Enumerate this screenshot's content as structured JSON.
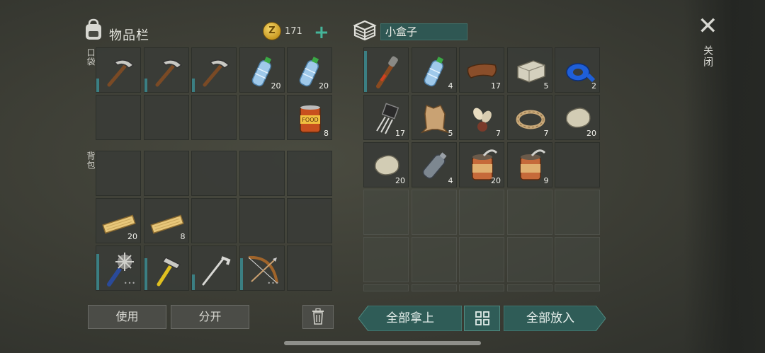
{
  "inventory": {
    "title": "物品栏",
    "coins": "171",
    "coin_symbol": "Z",
    "add_label": "+",
    "pockets_label": "口袋",
    "backpack_label": "背包",
    "pockets": [
      {
        "item": "pickaxe-icon",
        "count": "",
        "durability": 0.3
      },
      {
        "item": "pickaxe-icon",
        "count": "",
        "durability": 0.3
      },
      {
        "item": "pickaxe-icon",
        "count": "",
        "durability": 0.3
      },
      {
        "item": "water-bottle-icon",
        "count": "20"
      },
      {
        "item": "water-bottle-icon",
        "count": "20"
      },
      {
        "item": "",
        "count": ""
      },
      {
        "item": "",
        "count": ""
      },
      {
        "item": "",
        "count": ""
      },
      {
        "item": "",
        "count": ""
      },
      {
        "item": "canned-food-icon",
        "count": "8"
      }
    ],
    "backpack": [
      {
        "item": "",
        "count": ""
      },
      {
        "item": "",
        "count": ""
      },
      {
        "item": "",
        "count": ""
      },
      {
        "item": "",
        "count": ""
      },
      {
        "item": "",
        "count": ""
      },
      {
        "item": "plank-icon",
        "count": "20"
      },
      {
        "item": "plank-icon",
        "count": "8"
      },
      {
        "item": "",
        "count": ""
      },
      {
        "item": "",
        "count": ""
      },
      {
        "item": "",
        "count": ""
      },
      {
        "item": "spiked-club-icon",
        "count": "",
        "durability": 0.8,
        "dots": "•••"
      },
      {
        "item": "hammer-icon",
        "count": "",
        "durability": 0.7
      },
      {
        "item": "hoe-icon",
        "count": "",
        "durability": 0.35
      },
      {
        "item": "bow-icon",
        "count": "",
        "durability": 0.7,
        "dots": "•••"
      },
      {
        "item": "",
        "count": ""
      }
    ],
    "use_label": "使用",
    "split_label": "分开",
    "trash_icon": "trash-icon"
  },
  "container": {
    "title": "小盒子",
    "items": [
      {
        "item": "torch-icon",
        "count": "",
        "durability": 0.9
      },
      {
        "item": "water-bottle-icon",
        "count": "4"
      },
      {
        "item": "leather-icon",
        "count": "17"
      },
      {
        "item": "stone-block-icon",
        "count": "5"
      },
      {
        "item": "duct-tape-icon",
        "count": "2"
      },
      {
        "item": "transistor-icon",
        "count": "17"
      },
      {
        "item": "animal-hide-icon",
        "count": "5"
      },
      {
        "item": "seeds-icon",
        "count": "7"
      },
      {
        "item": "rope-icon",
        "count": "7"
      },
      {
        "item": "stone-icon",
        "count": "20"
      },
      {
        "item": "stone-icon",
        "count": "20"
      },
      {
        "item": "empty-bottle-icon",
        "count": "4"
      },
      {
        "item": "open-can-icon",
        "count": "20"
      },
      {
        "item": "open-can-icon",
        "count": "9"
      },
      {
        "item": "",
        "count": ""
      }
    ],
    "take_all_label": "全部拿上",
    "sort_icon": "grid-sort-icon",
    "put_all_label": "全部放入"
  },
  "close": {
    "icon": "close-icon",
    "label": "关闭"
  },
  "colors": {
    "accent_teal": "#2f5c57",
    "durability": "#3b7f83",
    "plus": "#45b59a"
  }
}
